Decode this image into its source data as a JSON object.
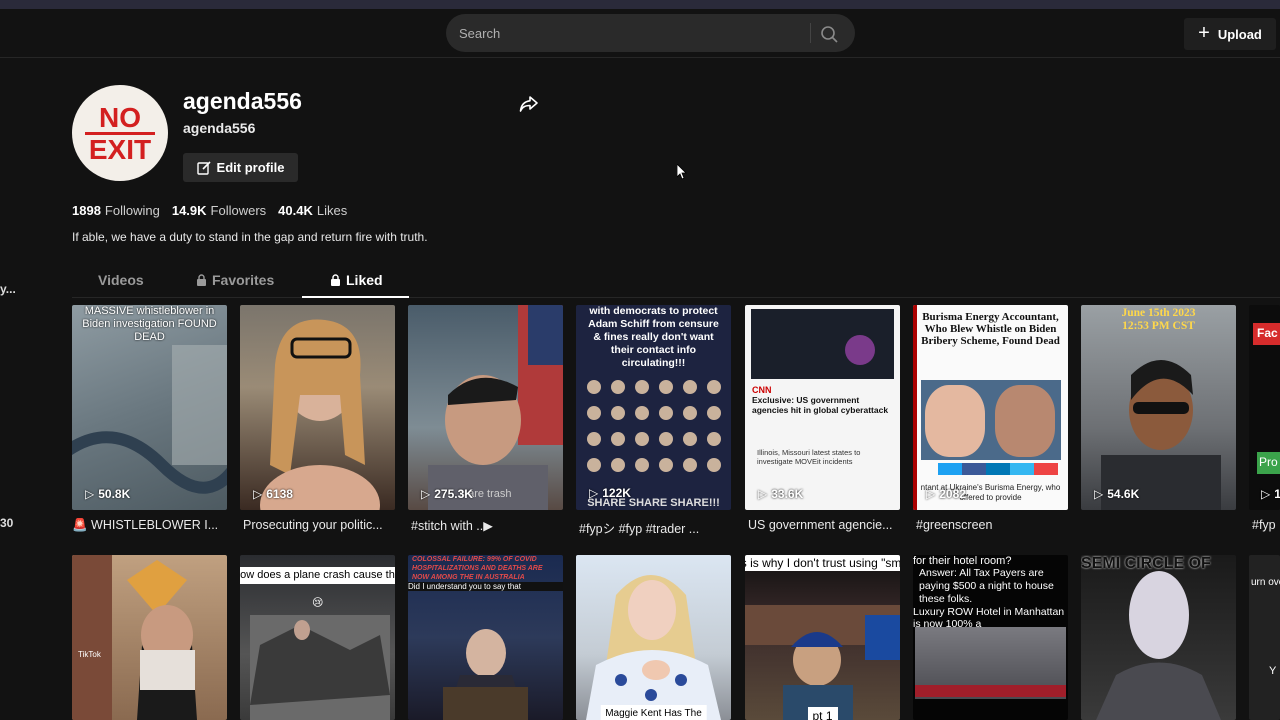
{
  "search": {
    "placeholder": "Search"
  },
  "header": {
    "upload_label": "Upload"
  },
  "left_edge": {
    "text1": "y...",
    "text2": "30"
  },
  "profile": {
    "avatar_top": "NO",
    "avatar_bottom": "EXIT",
    "nickname": "agenda556",
    "username": "agenda556",
    "edit_label": "Edit profile",
    "following_count": "1898",
    "following_label": "Following",
    "followers_count": "14.9K",
    "followers_label": "Followers",
    "likes_count": "40.4K",
    "likes_label": "Likes",
    "bio": "If able, we have a duty to stand in the gap and return fire with truth."
  },
  "tabs": [
    {
      "label": "Videos"
    },
    {
      "label": "Favorites"
    },
    {
      "label": "Liked"
    }
  ],
  "videos_row1": [
    {
      "overlay": "MASSIVE whistleblower in Biden investigation FOUND DEAD",
      "views": "50.8K",
      "caption": "🚨 WHISTLEBLOWER I..."
    },
    {
      "overlay": "",
      "views": "6138",
      "caption": "Prosecuting your politic..."
    },
    {
      "overlay": "s are trash",
      "views": "275.3K",
      "caption": "#stitch with ..▶"
    },
    {
      "overlay": "with democrats to protect Adam Schiff from censure & fines really don't want their contact info circulating!!!",
      "overlay2": "SHARE SHARE SHARE!!!",
      "views": "122K",
      "caption": "#fypシ #fyp #trader ..."
    },
    {
      "overlay": "Exclusive: US government agencies hit in global cyberattack",
      "overlay2": "Illinois, Missouri latest states to investigate MOVEit incidents",
      "views": "33.6K",
      "caption": "US government agencie..."
    },
    {
      "overlay": "Burisma Energy Accountant, Who Blew Whistle on Biden Bribery Scheme, Found Dead",
      "overlay2": "ntant at Ukraine's Burisma Energy, who offered to provide",
      "views": "2082",
      "caption": "#greenscreen"
    },
    {
      "overlay": "June 15th 2023",
      "overlay2": "12:53 PM CST",
      "views": "54.6K",
      "caption": ""
    },
    {
      "overlay": "Fac",
      "overlay2": "Pro",
      "views": "1",
      "caption": "#fyp"
    }
  ],
  "videos_row2": [
    {
      "text": ""
    },
    {
      "text": "How does a plane crash cause this",
      "text2": "Did I understand you to say that"
    },
    {
      "text": "COLOSSAL FAILURE: 99% OF COVID HOSPITALIZATIONS AND DEATHS ARE NOW AMONG THE IN AUSTRALIA",
      "text2": "Did I understand you to say that"
    },
    {
      "text": "Maggie Kent Has The"
    },
    {
      "text": "And this is why I don't trust using \"smart\" shit",
      "text2": "pt 1"
    },
    {
      "text": "for their hotel room?",
      "text2": "Answer:  All Tax Payers are paying $500 a night to house these folks.",
      "text3": "Luxury ROW Hotel in Manhattan is now 100% a"
    },
    {
      "text": "SEMI CIRCLE OF"
    },
    {
      "text": "urn over",
      "text2": "Y"
    }
  ]
}
